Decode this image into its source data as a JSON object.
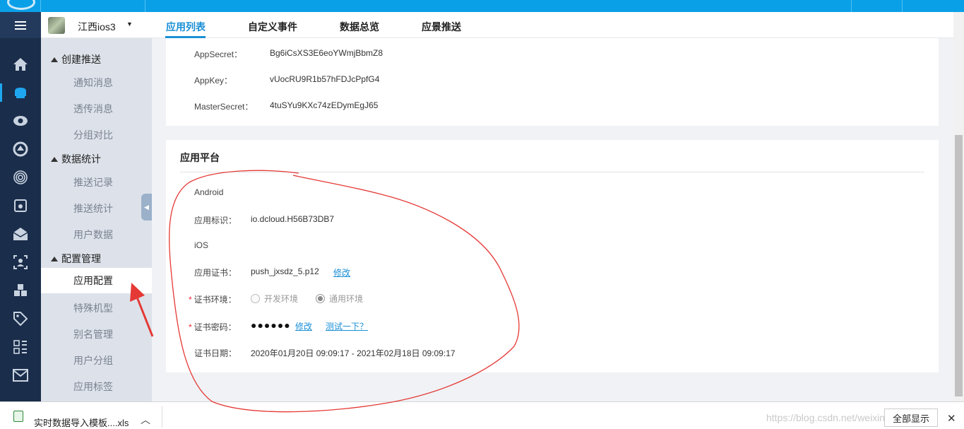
{
  "header": {
    "app_name": "江西ios3",
    "tabs": [
      "应用列表",
      "自定义事件",
      "数据总览",
      "应景推送"
    ],
    "active_tab": "应用列表"
  },
  "sidebar": {
    "groups": [
      {
        "title": "创建推送",
        "items": [
          "通知消息",
          "透传消息",
          "分组对比"
        ]
      },
      {
        "title": "数据统计",
        "items": [
          "推送记录",
          "推送统计",
          "用户数据"
        ]
      },
      {
        "title": "配置管理",
        "items": [
          "应用配置",
          "特殊机型",
          "别名管理",
          "用户分组",
          "应用标签"
        ]
      }
    ],
    "active_item": "应用配置"
  },
  "keys": [
    {
      "label": "AppSecret：",
      "value": "Bg6iCsXS3E6eoYWmjBbmZ8"
    },
    {
      "label": "AppKey：",
      "value": "vUocRU9R1b57hFDJcPpfG4"
    },
    {
      "label": "MasterSecret：",
      "value": "4tuSYu9KXc74zEDymEgJ65"
    }
  ],
  "platform": {
    "title": "应用平台",
    "android_label": "Android",
    "app_id_label": "应用标识：",
    "app_id_value": "io.dcloud.H56B73DB7",
    "ios_label": "iOS",
    "cert_label": "应用证书：",
    "cert_value": "push_jxsdz_5.p12",
    "cert_edit": "修改",
    "env_label": "证书环境：",
    "env_options": [
      "开发环境",
      "通用环境"
    ],
    "env_selected": "通用环境",
    "pwd_label": "证书密码：",
    "pwd_value": "●●●●●●",
    "pwd_edit": "修改",
    "pwd_test": "测试一下？",
    "date_label": "证书日期：",
    "date_value": "2020年01月20日 09:09:17 - 2021年02月18日 09:09:17",
    "required_mark": "*"
  },
  "download_bar": {
    "file_name": "实时数据导入模板....xls",
    "show_all": "全部显示",
    "watermark": "https://blog.csdn.net/weixin_..."
  },
  "icons": [
    "menu-icon",
    "home-icon",
    "push-icon",
    "eye-icon",
    "headset-icon",
    "fingerprint-icon",
    "device-icon",
    "mail-open-icon",
    "user-scan-icon",
    "cubes-icon",
    "tag-icon",
    "apps-grid-icon",
    "mail-icon"
  ],
  "annotation_color": "#e53935",
  "accent_color": "#1a8fd6"
}
